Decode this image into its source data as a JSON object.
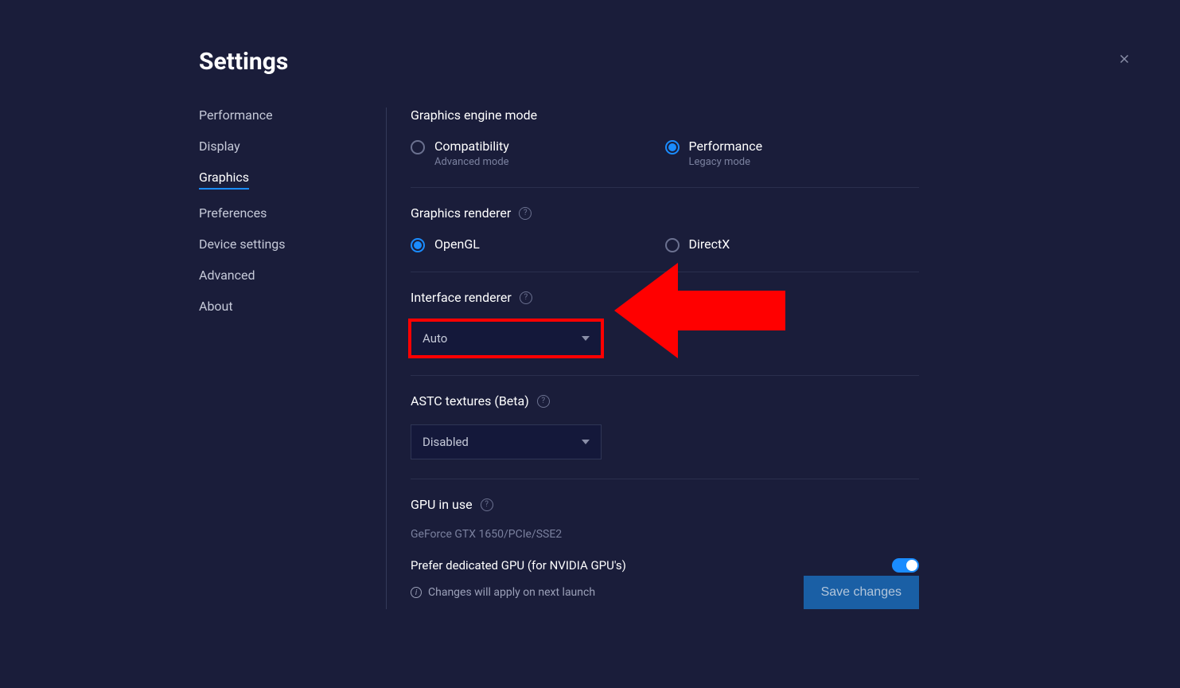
{
  "title": "Settings",
  "sidebar": {
    "items": [
      {
        "label": "Performance"
      },
      {
        "label": "Display"
      },
      {
        "label": "Graphics"
      },
      {
        "label": "Preferences"
      },
      {
        "label": "Device settings"
      },
      {
        "label": "Advanced"
      },
      {
        "label": "About"
      }
    ],
    "active_index": 2
  },
  "graphics": {
    "engine_mode": {
      "title": "Graphics engine mode",
      "options": [
        {
          "label": "Compatibility",
          "sub": "Advanced mode"
        },
        {
          "label": "Performance",
          "sub": "Legacy mode"
        }
      ],
      "selected_index": 1
    },
    "renderer": {
      "title": "Graphics renderer",
      "options": [
        {
          "label": "OpenGL"
        },
        {
          "label": "DirectX"
        }
      ],
      "selected_index": 0
    },
    "interface_renderer": {
      "title": "Interface renderer",
      "value": "Auto"
    },
    "astc": {
      "title": "ASTC textures (Beta)",
      "value": "Disabled"
    },
    "gpu": {
      "title": "GPU in use",
      "name": "GeForce GTX 1650/PCIe/SSE2",
      "prefer_label": "Prefer dedicated GPU (for NVIDIA GPU's)",
      "prefer_on": true
    }
  },
  "footer": {
    "info": "Changes will apply on next launch",
    "save": "Save changes"
  }
}
